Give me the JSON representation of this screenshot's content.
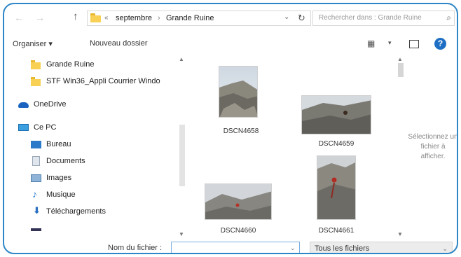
{
  "address": {
    "back_glyph": "←",
    "forward_glyph": "→",
    "up_glyph": "↑",
    "prefix": "«",
    "crumbs": [
      "septembre",
      "Grande Ruine"
    ],
    "separator": "›",
    "dropdown_glyph": "⌄",
    "refresh_glyph": "↻"
  },
  "search": {
    "placeholder": "Rechercher dans : Grande Ruine",
    "icon_glyph": "⌕"
  },
  "toolbar": {
    "organiser": "Organiser ▾",
    "new_folder": "Nouveau dossier",
    "view_glyph": "▦",
    "view_drop": "▾",
    "help_glyph": "?"
  },
  "nav": {
    "items": [
      {
        "label": "Grande Ruine",
        "icon": "folder-icon"
      },
      {
        "label": "STF Win36_Appli Courrier Windo",
        "icon": "folder-icon"
      },
      {
        "label": "OneDrive",
        "icon": "cloud-icon"
      },
      {
        "label": "Ce PC",
        "icon": "computer-icon"
      },
      {
        "label": "Bureau",
        "icon": "desktop-icon"
      },
      {
        "label": "Documents",
        "icon": "documents-icon"
      },
      {
        "label": "Images",
        "icon": "pictures-icon"
      },
      {
        "label": "Musique",
        "icon": "music-icon"
      },
      {
        "label": "Téléchargements",
        "icon": "downloads-icon"
      }
    ],
    "music_glyph": "♪",
    "down_glyph": "⬇"
  },
  "files": [
    {
      "name": "DSCN4658"
    },
    {
      "name": "DSCN4659"
    },
    {
      "name": "DSCN4660"
    },
    {
      "name": "DSCN4661"
    }
  ],
  "preview": {
    "message": "Sélectionnez un fichier à afficher."
  },
  "bottom": {
    "filename_label": "Nom du fichier :",
    "filename_value": "",
    "filter_value": "Tous les fichiers",
    "dropdown_glyph": "⌄"
  },
  "colors": {
    "frame_border": "#2f86c6",
    "help_blue": "#1e6fc4",
    "folder_yellow": "#f7d054"
  }
}
